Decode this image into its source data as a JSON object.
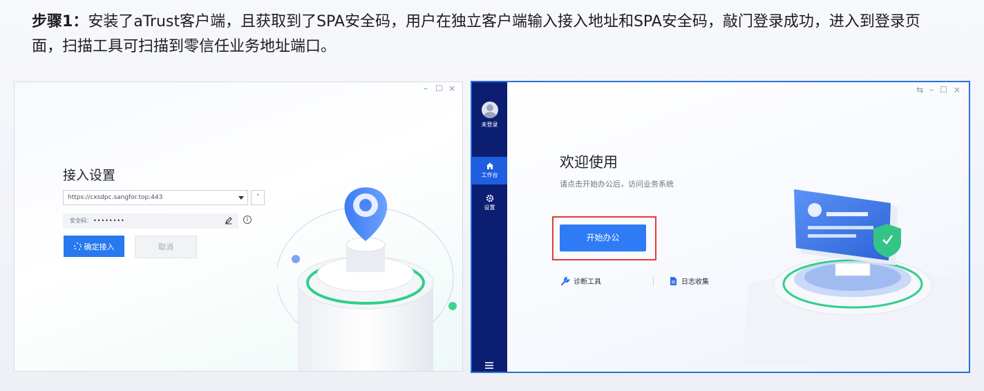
{
  "caption": {
    "lead": "步骤1：",
    "text": "安装了aTrust客户端，且获取到了SPA安全码，用户在独立客户端输入接入地址和SPA安全码，敲门登录成功，进入到登录页面，扫描工具可扫描到零信任业务地址端口。"
  },
  "left_window": {
    "controls": {
      "minimize": "–",
      "maximize": "☐",
      "close": "×"
    },
    "title": "接入设置",
    "address": {
      "value": "https://cxsdpc.sangfor.top:443"
    },
    "collapse_glyph": "˄",
    "security_code": {
      "label": "安全码：",
      "value": "••••••••"
    },
    "info_glyph": "i",
    "confirm_label": "确定接入",
    "cancel_label": "取消"
  },
  "right_window": {
    "controls": {
      "switch": "⇆",
      "minimize": "–",
      "maximize": "☐",
      "close": "×"
    },
    "sidebar": {
      "user_label": "未登录",
      "items": [
        {
          "label": "工作台",
          "icon": "home-icon",
          "active": true
        },
        {
          "label": "设置",
          "icon": "gear-icon",
          "active": false
        }
      ],
      "menu_icon": "hamburger-menu-icon"
    },
    "welcome_title": "欢迎使用",
    "subtitle": "请点击开始办公后，访问业务系统",
    "start_label": "开始办公",
    "tools": [
      {
        "label": "诊断工具",
        "icon": "wrench-icon"
      },
      {
        "label": "日志收集",
        "icon": "document-icon"
      }
    ]
  },
  "colors": {
    "primary_blue": "#2878f0",
    "sidebar_navy": "#0b1e72",
    "sidebar_active": "#1d5fe0",
    "highlight_red": "#e23b3b",
    "accent_green": "#2fcf8a"
  }
}
